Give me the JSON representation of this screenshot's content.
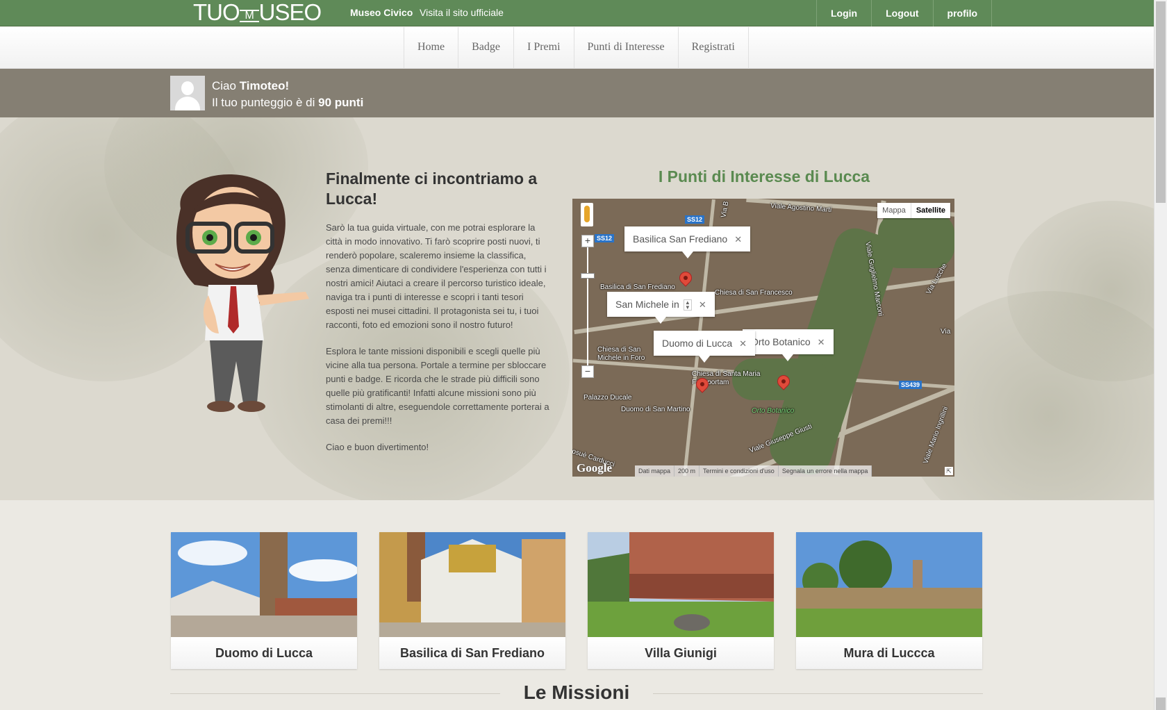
{
  "header": {
    "logo_left": "TUO",
    "logo_mid": "M",
    "logo_right": "USEO",
    "museum_name": "Museo Civico",
    "site_link": "Visita il sito ufficiale",
    "links": [
      "Login",
      "Logout",
      "profilo"
    ]
  },
  "nav": {
    "items": [
      "Home",
      "Badge",
      "I Premi",
      "Punti di Interesse",
      "Registrati"
    ]
  },
  "user": {
    "greeting_prefix": "Ciao ",
    "name": "Timoteo!",
    "score_prefix": "Il tuo punteggio è di ",
    "score": "90 punti"
  },
  "intro": {
    "title": "Finalmente ci incontriamo a Lucca!",
    "paragraphs": [
      "Sarò la tua guida virtuale, con me potrai esplorare la città in modo innovativo. Ti farò scoprire posti nuovi, ti renderò popolare, scaleremo insieme la classifica, senza dimenticare di condividere l'esperienza con tutti i nostri amici! Aiutaci a creare il percorso turistico ideale, naviga tra i punti di interesse e scopri i tanti tesori esposti nei musei cittadini. Il protagonista sei tu, i tuoi racconti, foto ed emozioni sono il nostro futuro!",
      "Esplora le tante missioni disponibili e scegli quelle più vicine alla tua persona. Portale a termine per sbloccare punti e badge. E ricorda che le strade più difficili sono quelle più gratificanti! Infatti alcune missioni sono più stimolanti di altre, eseguendole correttamente porterai a casa dei premi!!!",
      "Ciao e buon divertimento!"
    ]
  },
  "map": {
    "title": "I Punti di Interesse di Lucca",
    "type_options": [
      "Mappa",
      "Satellite"
    ],
    "info_windows": [
      "Basilica San Frediano",
      "San Michele in",
      "Duomo di Lucca",
      "Orto Botanico"
    ],
    "labels": {
      "l1": "Basilica di San Frediano",
      "l2": "Chiesa di San Francesco",
      "l3": "Chiesa di San Michele in Foro",
      "l4": "Chiesa di Santa Maria Forisportam",
      "l5": "Palazzo Ducale",
      "l6": "Duomo di San Martino",
      "l7": "Orto Botanico",
      "l8": "Viale Agostino Marti",
      "l9": "Viale Guglielmo Marconi",
      "l10": "Via Lucche",
      "l11": "Viale Giuseppe Giusti",
      "l12": "Viale Mario Ingrillini",
      "l13": "Via B",
      "l14": "Via",
      "l15": "osuè Carducci"
    },
    "shields": [
      "SS12",
      "SS12",
      "SS439"
    ],
    "footer": [
      "Dati mappa",
      "200 m",
      "Termini e condizioni d'uso",
      "Segnala un errore nella mappa"
    ],
    "google": "Google"
  },
  "cards": [
    {
      "label": "Duomo di Lucca"
    },
    {
      "label": "Basilica di San Frediano"
    },
    {
      "label": "Villa Giunigi"
    },
    {
      "label": "Mura di Luccca"
    }
  ],
  "missions": {
    "title": "Le Missioni"
  }
}
